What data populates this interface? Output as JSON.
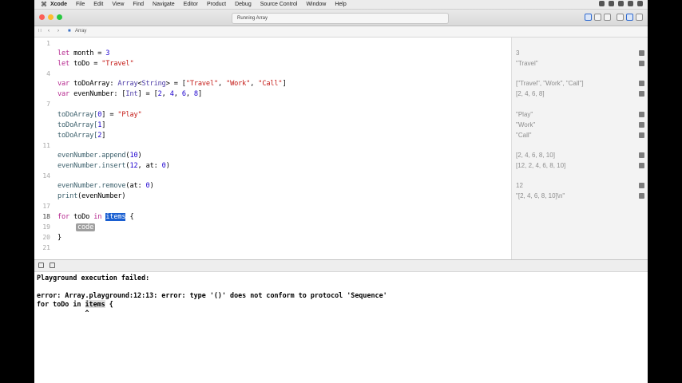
{
  "menubar": {
    "apple": "",
    "items": [
      "Xcode",
      "File",
      "Edit",
      "View",
      "Find",
      "Navigate",
      "Editor",
      "Product",
      "Debug",
      "Source Control",
      "Window",
      "Help"
    ]
  },
  "toolbar": {
    "status": "Running Array"
  },
  "jumpbar": {
    "file": "Array"
  },
  "editor": {
    "line_numbers": [
      "1",
      "4",
      "7",
      "11",
      "14",
      "17",
      "18",
      "19",
      "20",
      "21"
    ],
    "code": {
      "l2": [
        "let",
        " month = ",
        "3"
      ],
      "l3": [
        "let",
        " toDo = ",
        "\"Travel\""
      ],
      "l5": [
        "var",
        " toDoArray: ",
        "Array",
        "<",
        "String",
        "> = [",
        "\"Travel\"",
        ", ",
        "\"Work\"",
        ", ",
        "\"Call\"",
        "]"
      ],
      "l6": [
        "var",
        " evenNumber: [",
        "Int",
        "] = [",
        "2",
        ", ",
        "4",
        ", ",
        "6",
        ", ",
        "8",
        "]"
      ],
      "l8": [
        "toDoArray[",
        "0",
        "] = ",
        "\"Play\""
      ],
      "l9": [
        "toDoArray[",
        "1",
        "]"
      ],
      "l10": [
        "toDoArray[",
        "2",
        "]"
      ],
      "l12": [
        "evenNumber.",
        "append",
        "(",
        "10",
        ")"
      ],
      "l13": [
        "evenNumber.",
        "insert",
        "(",
        "12",
        ", at: ",
        "0",
        ")"
      ],
      "l15": [
        "evenNumber.",
        "remove",
        "(at: ",
        "0",
        ")"
      ],
      "l16": [
        "print",
        "(evenNumber)"
      ],
      "l18": [
        "for",
        " toDo ",
        "in",
        " ",
        "items",
        " {"
      ],
      "l19": [
        "code"
      ],
      "l20": [
        "}"
      ]
    }
  },
  "results": [
    "3",
    "\"Travel\"",
    "[\"Travel\", \"Work\", \"Call\"]",
    "[2, 4, 6, 8]",
    "\"Play\"",
    "\"Work\"",
    "\"Call\"",
    "[2, 4, 6, 8, 10]",
    "[12, 2, 4, 6, 8, 10]",
    "12",
    "\"[2, 4, 6, 8, 10]\\n\""
  ],
  "console": {
    "line1": "Playground execution failed:",
    "line2": "error: Array.playground:12:13: error: type '()' does not conform to protocol 'Sequence'",
    "line3_pre": "for toDo in ",
    "line3_mark": "items",
    "line3_post": " {",
    "line4": "            ^"
  }
}
